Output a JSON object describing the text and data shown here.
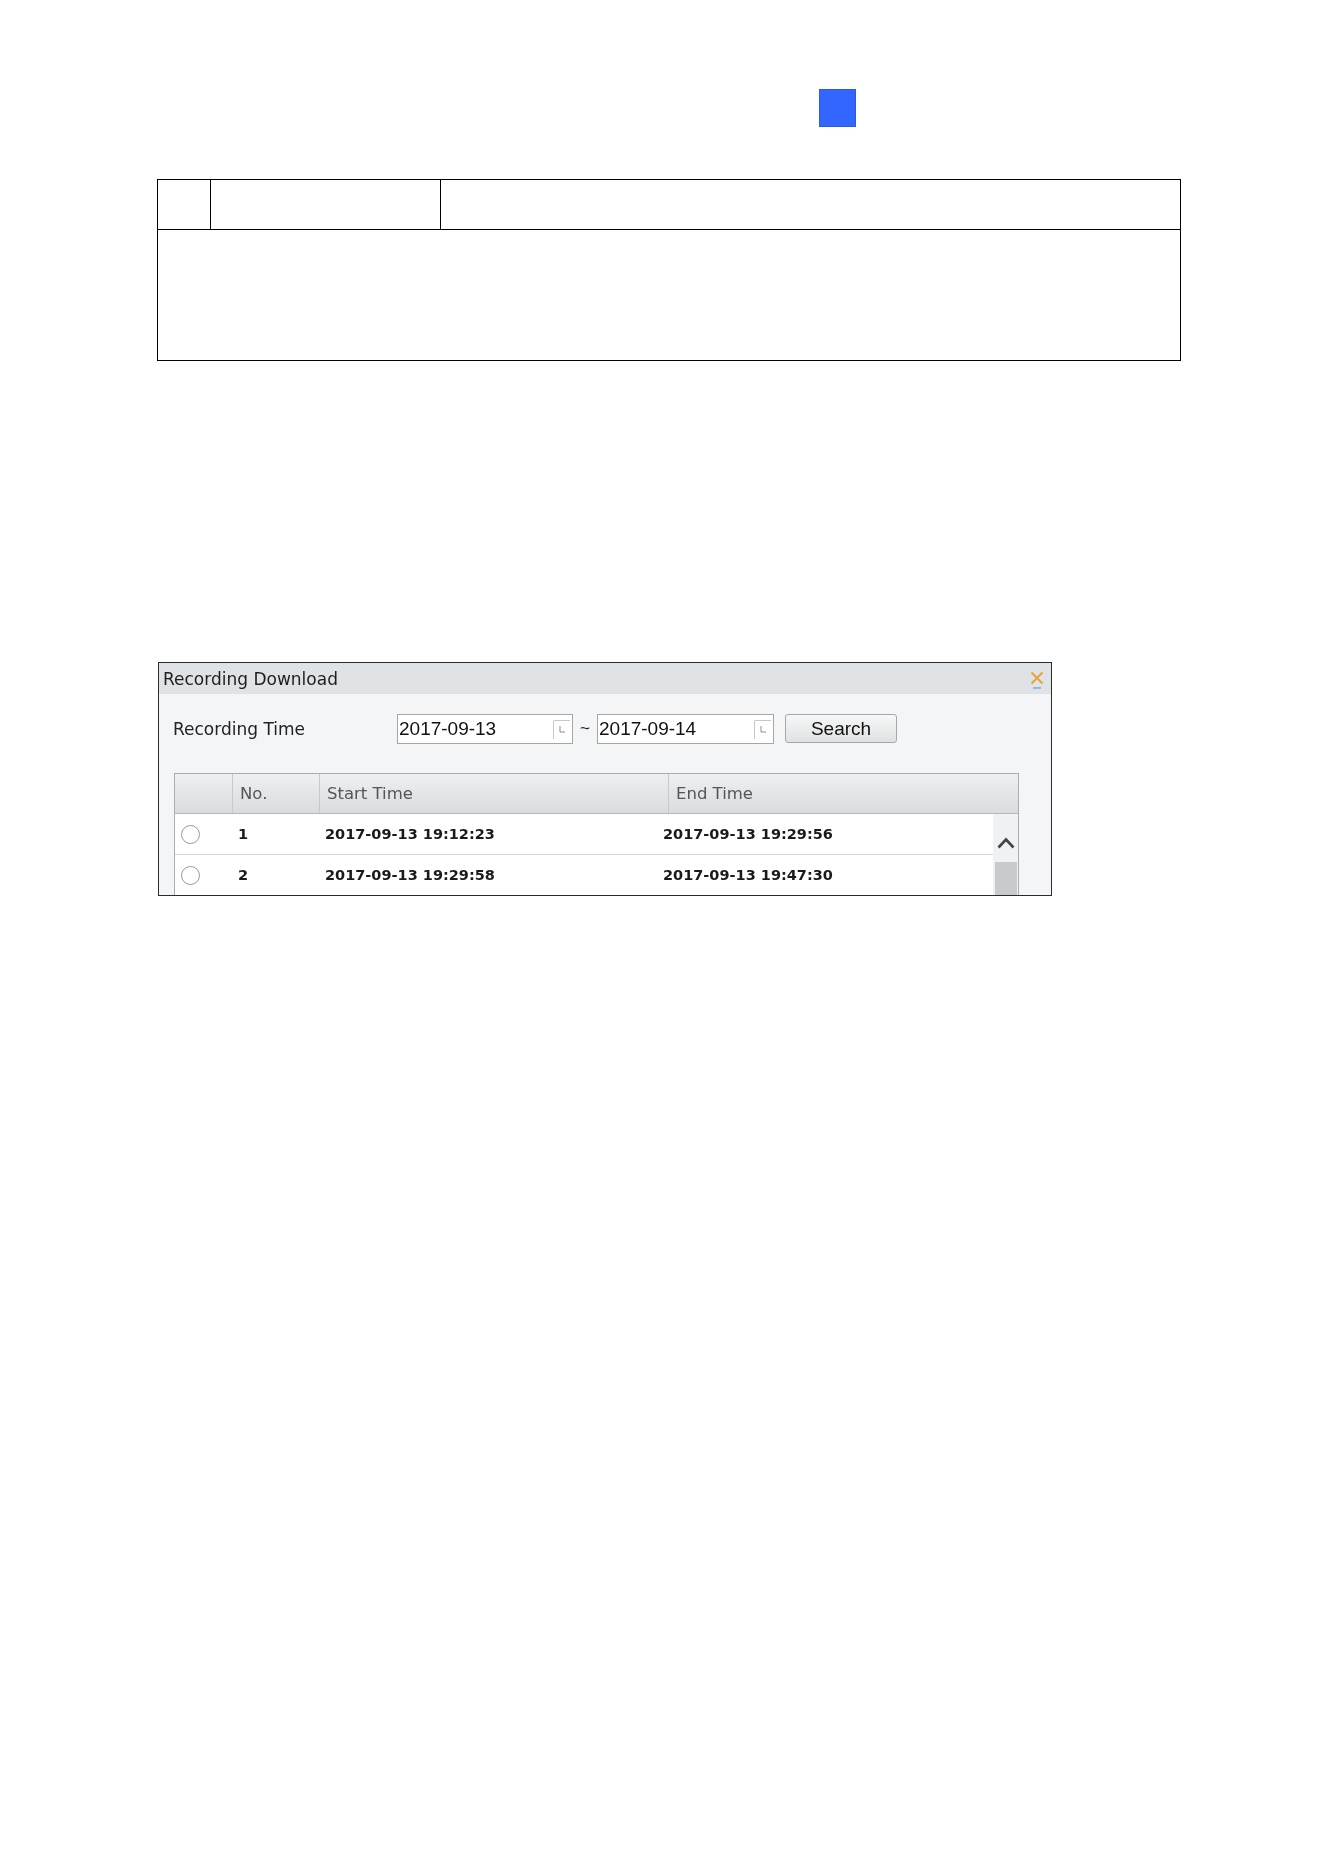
{
  "dialog": {
    "title": "Recording Download"
  },
  "filter": {
    "label": "Recording Time",
    "start_date": {
      "value": "2017-09-13"
    },
    "separator": "~",
    "end_date": {
      "value": "2017-09-14"
    },
    "button": "Search"
  },
  "table": {
    "columns": [
      "No.",
      "Start Time",
      "End Time"
    ],
    "rows": [
      {
        "selected": false,
        "no": "1",
        "start_time": "2017-09-13 19:12:23",
        "end_time": "2017-09-13 19:29:56"
      },
      {
        "selected": false,
        "no": "2",
        "start_time": "2017-09-13 19:29:58",
        "end_time": "2017-09-13 19:47:30"
      }
    ]
  }
}
